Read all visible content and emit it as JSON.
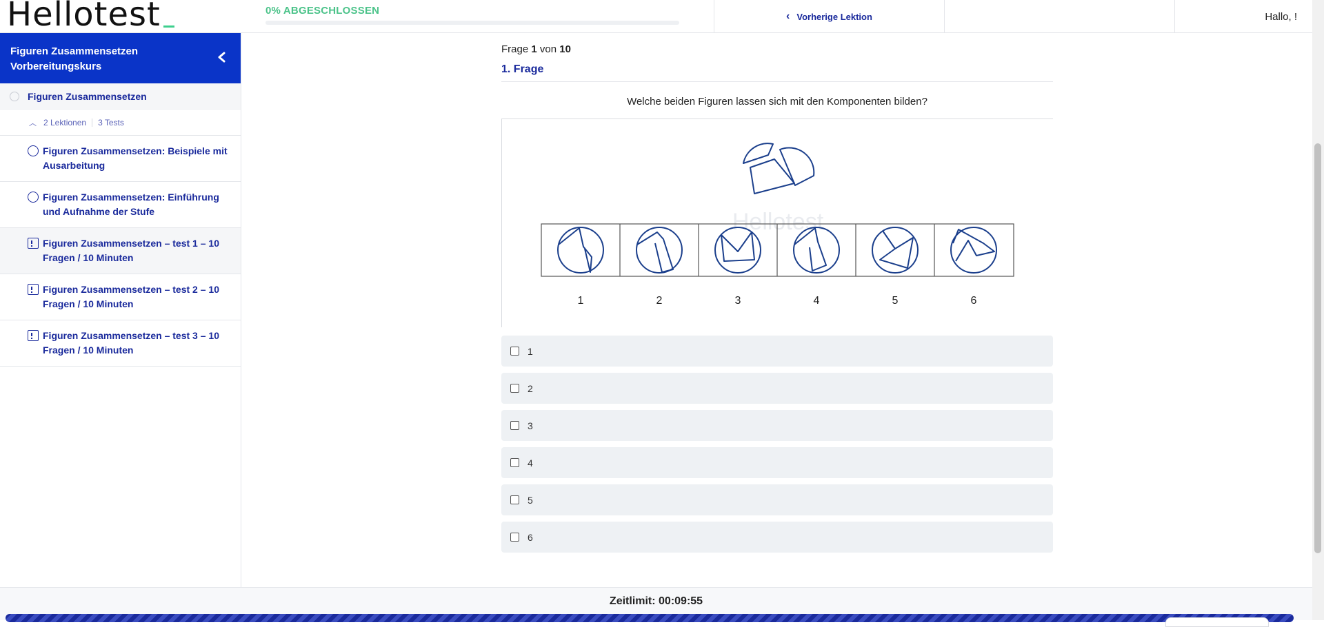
{
  "header": {
    "logo_text": "Hellotest",
    "progress_label": "0% ABGESCHLOSSEN",
    "progress_fraction": 0,
    "prev_lesson_label": "Vorherige Lektion",
    "greeting": "Hallo, !"
  },
  "sidebar": {
    "course_title": "Figuren Zusammensetzen Vorbereitungskurs",
    "section_title": "Figuren Zusammensetzen",
    "lessons_count": "2 Lektionen",
    "tests_count": "3 Tests",
    "items": [
      {
        "label": "Figuren Zusammensetzen: Beispiele mit Ausarbeitung",
        "type": "lesson"
      },
      {
        "label": "Figuren Zusammensetzen: Einführung und Aufnahme der Stufe",
        "type": "lesson"
      },
      {
        "label": "Figuren Zusammensetzen – test 1 – 10 Fragen / 10 Minuten",
        "type": "test"
      },
      {
        "label": "Figuren Zusammensetzen – test 2 – 10 Fragen / 10 Minuten",
        "type": "test"
      },
      {
        "label": "Figuren Zusammensetzen – test 3 – 10 Fragen / 10 Minuten",
        "type": "test"
      }
    ]
  },
  "quiz": {
    "count_prefix": "Frage",
    "current": "1",
    "count_middle": "von",
    "total": "10",
    "question_title": "1. Frage",
    "question_text": "Welche beiden Figuren lassen sich mit den Komponenten bilden?",
    "figure_watermark": "Hellotest",
    "figure_labels": [
      "1",
      "2",
      "3",
      "4",
      "5",
      "6"
    ],
    "options": [
      "1",
      "2",
      "3",
      "4",
      "5",
      "6"
    ]
  },
  "footer": {
    "time_label": "Zeitlimit: 00:09:55"
  },
  "colors": {
    "brand_blue": "#0a34c8",
    "link_blue": "#1a2a9c",
    "progress_green": "#4cc38a"
  }
}
